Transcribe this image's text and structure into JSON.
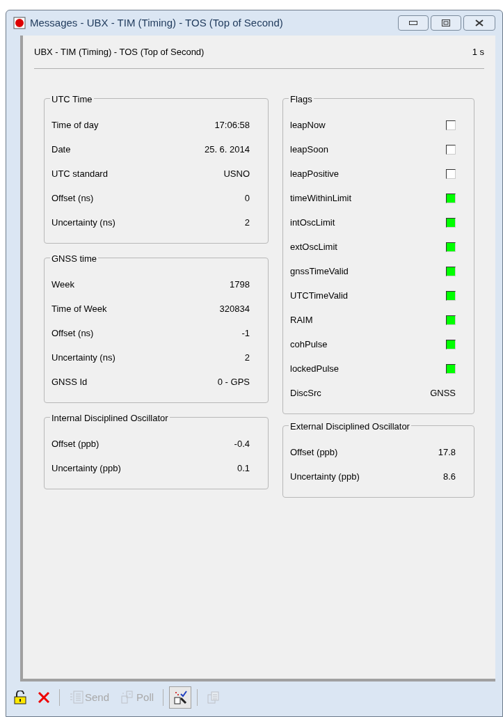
{
  "window": {
    "title": "Messages - UBX - TIM (Timing) - TOS (Top of Second)"
  },
  "header": {
    "title": "UBX - TIM (Timing) - TOS (Top of Second)",
    "rate": "1 s"
  },
  "left_groups": [
    {
      "title": "UTC Time",
      "rows": [
        {
          "label": "Time of day",
          "value": "17:06:58"
        },
        {
          "label": "Date",
          "value": "25. 6. 2014"
        },
        {
          "label": "UTC standard",
          "value": "USNO"
        },
        {
          "label": "Offset (ns)",
          "value": "0"
        },
        {
          "label": "Uncertainty (ns)",
          "value": "2"
        }
      ]
    },
    {
      "title": "GNSS time",
      "rows": [
        {
          "label": "Week",
          "value": "1798"
        },
        {
          "label": "Time of Week",
          "value": "320834"
        },
        {
          "label": "Offset (ns)",
          "value": "-1"
        },
        {
          "label": "Uncertainty (ns)",
          "value": "2"
        },
        {
          "label": "GNSS Id",
          "value": "0 - GPS"
        }
      ]
    },
    {
      "title": "Internal Disciplined Oscillator",
      "rows": [
        {
          "label": "Offset (ppb)",
          "value": "-0.4"
        },
        {
          "label": "Uncertainty (ppb)",
          "value": "0.1"
        }
      ]
    }
  ],
  "flags": {
    "title": "Flags",
    "rows": [
      {
        "kind": "flag",
        "label": "leapNow",
        "on": false
      },
      {
        "kind": "flag",
        "label": "leapSoon",
        "on": false
      },
      {
        "kind": "flag",
        "label": "leapPositive",
        "on": false
      },
      {
        "kind": "flag",
        "label": "timeWithinLimit",
        "on": true
      },
      {
        "kind": "flag",
        "label": "intOscLimit",
        "on": true
      },
      {
        "kind": "flag",
        "label": "extOscLimit",
        "on": true
      },
      {
        "kind": "flag",
        "label": "gnssTimeValid",
        "on": true
      },
      {
        "kind": "flag",
        "label": "UTCTimeValid",
        "on": true
      },
      {
        "kind": "flag",
        "label": "RAIM",
        "on": true
      },
      {
        "kind": "flag",
        "label": "cohPulse",
        "on": true
      },
      {
        "kind": "flag",
        "label": "lockedPulse",
        "on": true
      },
      {
        "kind": "value",
        "label": "DiscSrc",
        "value": "GNSS"
      }
    ]
  },
  "external": {
    "title": "External Disciplined Oscillator",
    "rows": [
      {
        "label": "Offset (ppb)",
        "value": "17.8"
      },
      {
        "label": "Uncertainty (ppb)",
        "value": "8.6"
      }
    ]
  },
  "toolbar": [
    {
      "kind": "lock",
      "disabled": false,
      "pressed": false
    },
    {
      "kind": "delete",
      "disabled": false,
      "pressed": false
    },
    {
      "kind": "send",
      "label": "Send",
      "disabled": true,
      "pressed": false
    },
    {
      "kind": "poll",
      "label": "Poll",
      "disabled": true,
      "pressed": false
    },
    {
      "kind": "autopoll",
      "disabled": false,
      "pressed": true
    },
    {
      "kind": "copy",
      "disabled": true,
      "pressed": false
    }
  ]
}
